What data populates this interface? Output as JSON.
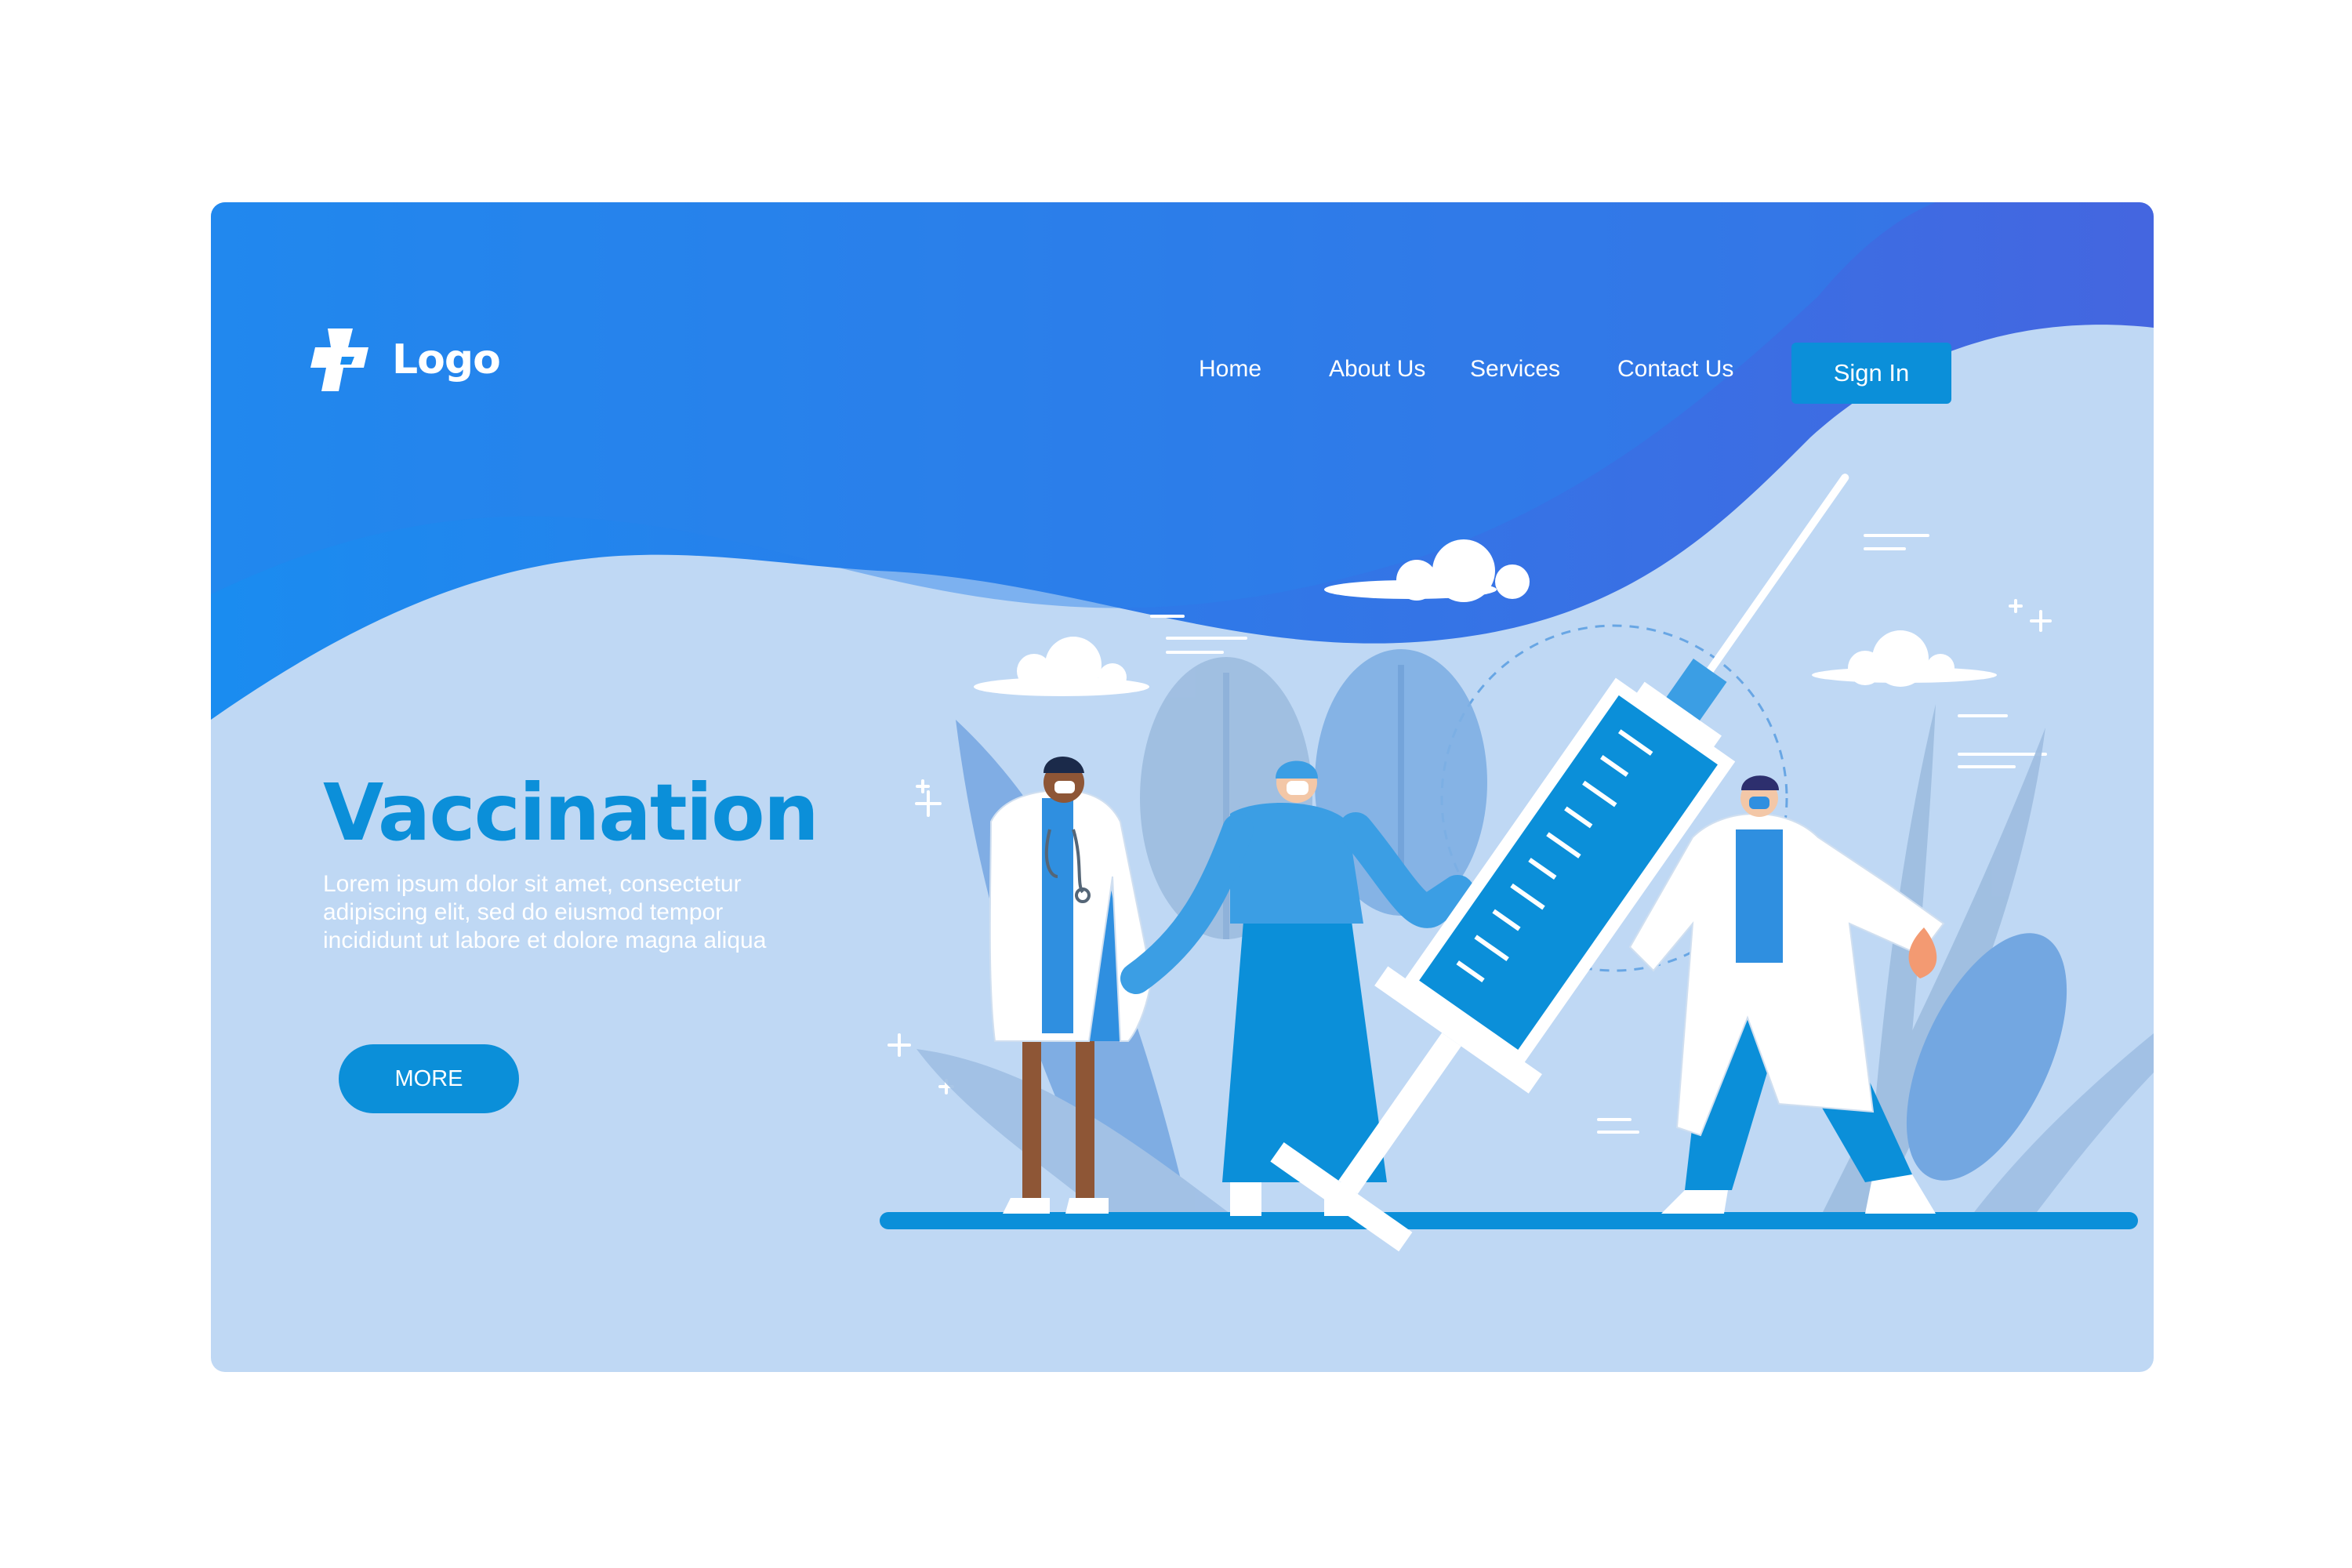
{
  "logo": {
    "text": "Logo",
    "icon": "cross-plus-icon"
  },
  "nav": {
    "home": "Home",
    "about": "About Us",
    "services": "Services",
    "contact": "Contact Us",
    "signin": "Sign In"
  },
  "hero": {
    "title": "Vaccination",
    "body": "Lorem ipsum dolor sit amet, consectetur adipiscing elit, sed do eiusmod tempor incididunt ut labore et dolore magna aliqua",
    "cta": "MORE"
  },
  "colors": {
    "accent": "#0b8fd9",
    "header_gradient_start": "#1a8cf0",
    "header_gradient_end": "#4466e0",
    "background_light": "#bfd8f4"
  },
  "illustration": {
    "subject": "medical-staff-with-giant-syringe",
    "icons": [
      "syringe-icon",
      "doctor-figure",
      "nurse-figure",
      "cloud-icon",
      "leaf-icon",
      "sparkle-icon"
    ]
  }
}
